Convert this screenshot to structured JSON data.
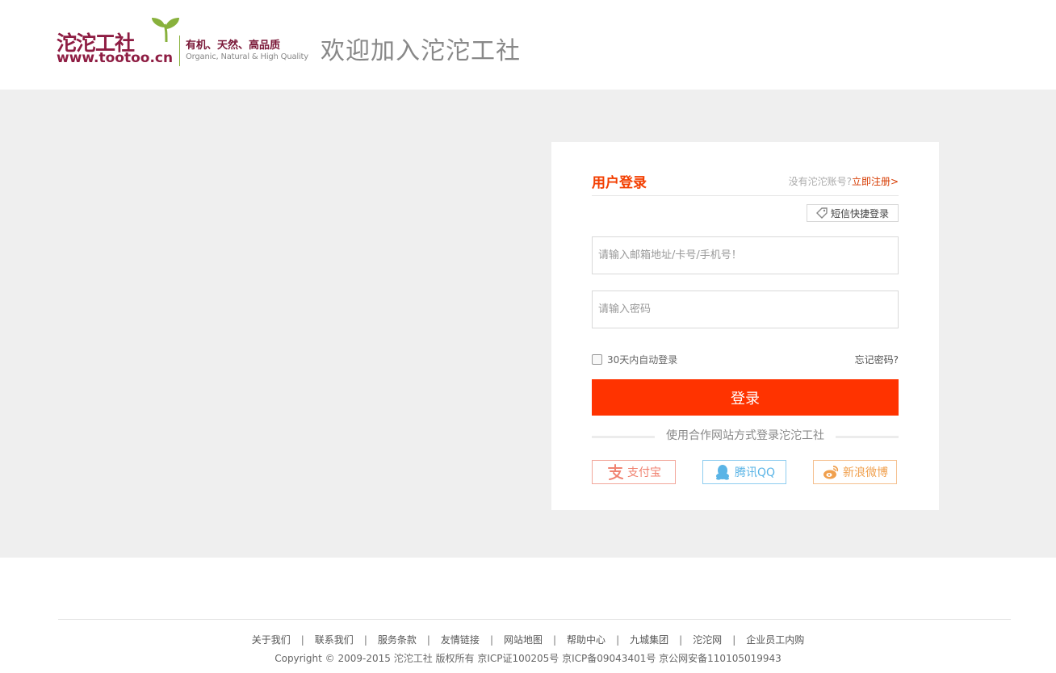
{
  "header": {
    "logo_cn": "沱沱工社",
    "logo_url": "www.tootoo.cn",
    "slogan_cn": "有机、天然、高品质",
    "slogan_en": "Organic, Natural & High Quality",
    "welcome": "欢迎加入沱沱工社"
  },
  "login": {
    "title": "用户登录",
    "no_account": "没有沱沱账号?",
    "register_link": "立即注册>",
    "sms_login": "短信快捷登录",
    "username_placeholder": "请输入邮箱地址/卡号/手机号！",
    "password_placeholder": "请输入密码",
    "remember_label": "30天内自动登录",
    "forgot_label": "忘记密码?",
    "submit_label": "登录",
    "partner_text": "使用合作网站方式登录沱沱工社",
    "partners": {
      "alipay": "支付宝",
      "qq": "腾讯QQ",
      "weibo": "新浪微博"
    }
  },
  "footer": {
    "links": [
      "关于我们",
      "联系我们",
      "服务条款",
      "友情链接",
      "网站地图",
      "帮助中心",
      "九城集团",
      "沱沱网",
      "企业员工内购"
    ],
    "copyright": "Copyright © 2009-2015 沱沱工社 版权所有 京ICP证100205号 京ICP备09043401号 京公网安备110105019943"
  },
  "colors": {
    "brand": "#8e1d43",
    "accent": "#ff3300",
    "leaf": "#88b13c"
  }
}
